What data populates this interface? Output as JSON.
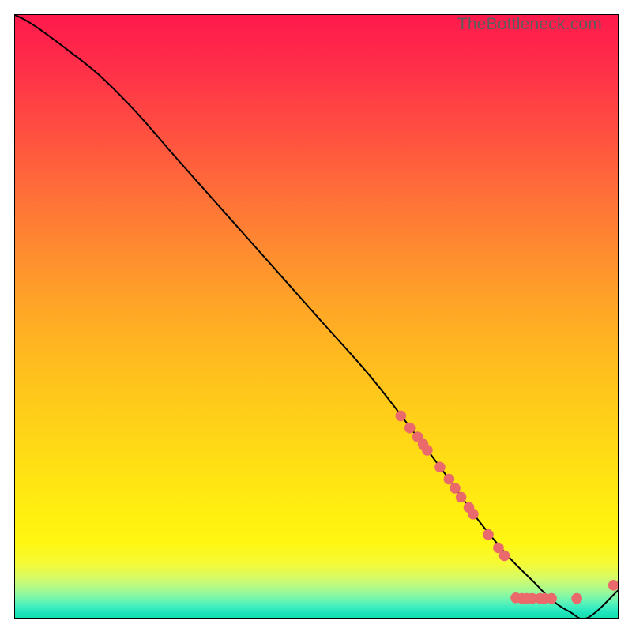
{
  "watermark": "TheBottleneck.com",
  "colors": {
    "line": "#000000",
    "marker_fill": "#ea6a6b",
    "marker_stroke": "#ea6a6b",
    "gradient_top": "#ff1a4c",
    "gradient_bottom": "#14dfad"
  },
  "chart_data": {
    "type": "line",
    "title": "",
    "xlabel": "",
    "ylabel": "",
    "xlim": [
      0,
      100
    ],
    "ylim": [
      0,
      100
    ],
    "series": [
      {
        "name": "curve",
        "x": [
          0,
          2,
          5,
          9,
          14,
          20,
          27,
          35,
          43,
          51,
          59,
          66,
          72,
          77,
          82,
          86,
          89,
          92,
          95,
          100
        ],
        "y": [
          100,
          99,
          97,
          94,
          90,
          84,
          76,
          67,
          58,
          49,
          40,
          31,
          23,
          16,
          10,
          6,
          3,
          1,
          0,
          4.5
        ]
      }
    ],
    "markers": [
      {
        "x": 64.0,
        "y": 33.5
      },
      {
        "x": 65.5,
        "y": 31.5
      },
      {
        "x": 66.8,
        "y": 30.0
      },
      {
        "x": 67.7,
        "y": 28.8
      },
      {
        "x": 68.4,
        "y": 27.8
      },
      {
        "x": 70.5,
        "y": 25.0
      },
      {
        "x": 72.0,
        "y": 23.0
      },
      {
        "x": 73.0,
        "y": 21.5
      },
      {
        "x": 74.0,
        "y": 20.0
      },
      {
        "x": 75.3,
        "y": 18.3
      },
      {
        "x": 76.0,
        "y": 17.2
      },
      {
        "x": 78.5,
        "y": 13.8
      },
      {
        "x": 80.2,
        "y": 11.6
      },
      {
        "x": 81.2,
        "y": 10.3
      },
      {
        "x": 83.1,
        "y": 3.3
      },
      {
        "x": 84.1,
        "y": 3.2
      },
      {
        "x": 84.9,
        "y": 3.2
      },
      {
        "x": 85.8,
        "y": 3.2
      },
      {
        "x": 87.1,
        "y": 3.2
      },
      {
        "x": 87.9,
        "y": 3.2
      },
      {
        "x": 89.0,
        "y": 3.2
      },
      {
        "x": 93.2,
        "y": 3.2
      },
      {
        "x": 99.3,
        "y": 5.4
      }
    ],
    "grid": false,
    "legend": false
  }
}
